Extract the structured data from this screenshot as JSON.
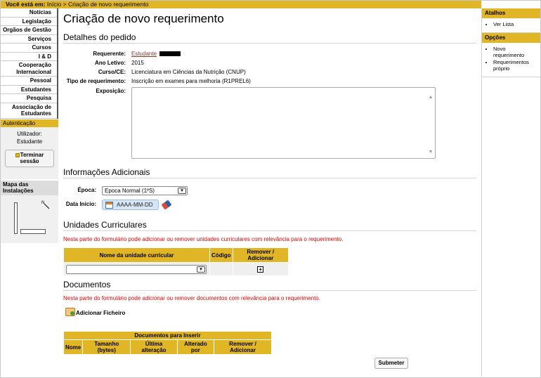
{
  "breadcrumb": {
    "label": "Você está em:",
    "home": "Início",
    "sep": ">",
    "current": "Criação de novo requerimento"
  },
  "leftnav": {
    "items": [
      "Notícias",
      "Legislação",
      "Orgãos de Gestão",
      "Serviços",
      "Cursos",
      "I & D",
      "Cooperação Internacional",
      "Pessoal",
      "Estudantes",
      "Pesquisa",
      "Associação de Estudantes"
    ],
    "auth_title": "Autenticação",
    "user_label": "Utilizador:",
    "user_name": "Estudante",
    "logout_label": "Terminar sessão",
    "map_title": "Mapa das Instalações"
  },
  "page": {
    "title": "Criação de novo requerimento",
    "details_title": "Detalhes do pedido",
    "requerente_label": "Requerente:",
    "requerente_value": "Estudante",
    "ano_label": "Ano Letivo:",
    "ano_value": "2015",
    "curso_label": "Curso/CE:",
    "curso_value": "Licenciatura em Ciências da Nutrição (CNUP)",
    "tipo_label": "Tipo de requerimento:",
    "tipo_value": "Inscrição em exames para melhoria (R1PREL6)",
    "exposicao_label": "Exposição:",
    "info_title": "Informações Adicionais",
    "epoca_label": "Época:",
    "epoca_value": "Epoca Normal (1ºS)",
    "data_label": "Data Início:",
    "data_placeholder": "AAAA-MM-DD",
    "uc_title": "Unidades Curriculares",
    "uc_note": "Nesta parte do formulário pode adicionar ou remover unidades curriculares com relevância para o requerimento.",
    "uc_headers": [
      "Nome da unidade curricular",
      "Código",
      "Remover / Adicionar"
    ],
    "docs_title": "Documentos",
    "docs_note": "Nesta parte do formulário pode adicionar ou remover documentos com relevância para o requerimento.",
    "add_file_label": "Adicionar Ficheiro",
    "docs_table_title": "Documentos para Inserir",
    "docs_headers": [
      "Nome",
      "Tamanho (bytes)",
      "Última alteração",
      "Alterado por",
      "Remover / Adicionar"
    ],
    "submit_label": "Submeter"
  },
  "rightnav": {
    "atalhos_title": "Atalhos",
    "atalhos_items": [
      "Ver Lista"
    ],
    "opcoes_title": "Opções",
    "opcoes_items": [
      "Novo requerimento",
      "Requerimentos próprio"
    ]
  },
  "colors": {
    "accent": "#e0b626",
    "alert": "#e00000",
    "link": "#8a3a2a"
  }
}
